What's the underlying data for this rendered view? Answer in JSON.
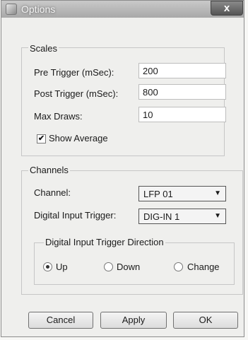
{
  "window": {
    "title": "Options",
    "close_glyph": "x"
  },
  "scales": {
    "legend": "Scales",
    "pre_trigger_label": "Pre Trigger (mSec):",
    "pre_trigger_value": "200",
    "post_trigger_label": "Post Trigger (mSec):",
    "post_trigger_value": "800",
    "max_draws_label": "Max Draws:",
    "max_draws_value": "10",
    "show_average_label": "Show Average",
    "show_average_checked": true
  },
  "channels": {
    "legend": "Channels",
    "channel_label": "Channel:",
    "channel_value": "LFP 01",
    "digital_input_label": "Digital Input Trigger:",
    "digital_input_value": "DIG-IN 1",
    "direction": {
      "legend": "Digital Input Trigger Direction",
      "options": [
        "Up",
        "Down",
        "Change"
      ],
      "selected": "Up"
    }
  },
  "buttons": {
    "cancel": "Cancel",
    "apply": "Apply",
    "ok": "OK"
  }
}
